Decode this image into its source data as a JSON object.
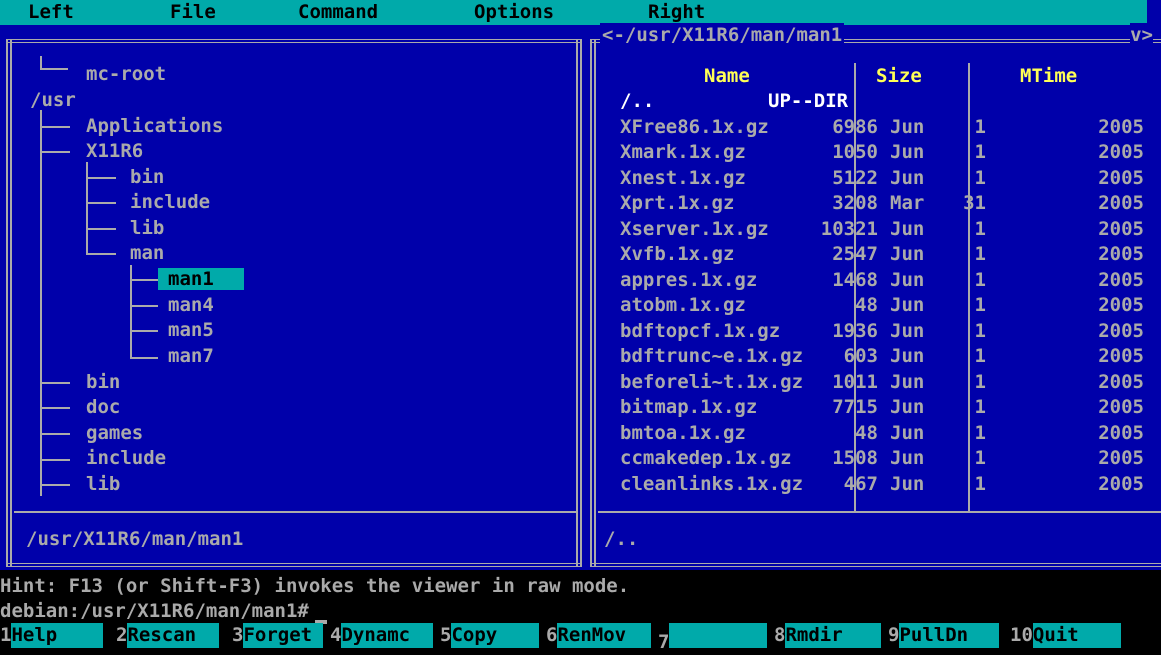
{
  "menu": {
    "items": [
      "Left",
      "File",
      "Command",
      "Options",
      "Right"
    ]
  },
  "left_panel": {
    "tree": [
      {
        "label": "mc-root"
      },
      {
        "label": "/usr"
      },
      {
        "label": "Applications"
      },
      {
        "label": "X11R6"
      },
      {
        "label": "bin"
      },
      {
        "label": "include"
      },
      {
        "label": "lib"
      },
      {
        "label": "man"
      },
      {
        "label": "man1"
      },
      {
        "label": "man4"
      },
      {
        "label": "man5"
      },
      {
        "label": "man7"
      },
      {
        "label": "bin"
      },
      {
        "label": "doc"
      },
      {
        "label": "games"
      },
      {
        "label": "include"
      },
      {
        "label": "lib"
      }
    ],
    "selected_label": "man1",
    "status_path": "/usr/X11R6/man/man1"
  },
  "right_panel": {
    "title": "<-/usr/X11R6/man/man1",
    "corner": "v>",
    "columns": {
      "name": "Name",
      "size": "Size",
      "mtime": "MTime"
    },
    "rows": [
      {
        "name": "/..",
        "size": "UP--DIR",
        "month": "",
        "day": "",
        "year": ""
      },
      {
        "name": "XFree86.1x.gz",
        "size": "6986",
        "month": "Jun",
        "day": "1",
        "year": "2005"
      },
      {
        "name": "Xmark.1x.gz",
        "size": "1050",
        "month": "Jun",
        "day": "1",
        "year": "2005"
      },
      {
        "name": "Xnest.1x.gz",
        "size": "5122",
        "month": "Jun",
        "day": "1",
        "year": "2005"
      },
      {
        "name": "Xprt.1x.gz",
        "size": "3208",
        "month": "Mar",
        "day": "31",
        "year": "2005"
      },
      {
        "name": "Xserver.1x.gz",
        "size": "10321",
        "month": "Jun",
        "day": "1",
        "year": "2005"
      },
      {
        "name": "Xvfb.1x.gz",
        "size": "2547",
        "month": "Jun",
        "day": "1",
        "year": "2005"
      },
      {
        "name": "appres.1x.gz",
        "size": "1468",
        "month": "Jun",
        "day": "1",
        "year": "2005"
      },
      {
        "name": "atobm.1x.gz",
        "size": "48",
        "month": "Jun",
        "day": "1",
        "year": "2005"
      },
      {
        "name": "bdftopcf.1x.gz",
        "size": "1936",
        "month": "Jun",
        "day": "1",
        "year": "2005"
      },
      {
        "name": "bdftrunc~e.1x.gz",
        "size": "603",
        "month": "Jun",
        "day": "1",
        "year": "2005"
      },
      {
        "name": "beforeli~t.1x.gz",
        "size": "1011",
        "month": "Jun",
        "day": "1",
        "year": "2005"
      },
      {
        "name": "bitmap.1x.gz",
        "size": "7715",
        "month": "Jun",
        "day": "1",
        "year": "2005"
      },
      {
        "name": "bmtoa.1x.gz",
        "size": "48",
        "month": "Jun",
        "day": "1",
        "year": "2005"
      },
      {
        "name": "ccmakedep.1x.gz",
        "size": "1508",
        "month": "Jun",
        "day": "1",
        "year": "2005"
      },
      {
        "name": "cleanlinks.1x.gz",
        "size": "467",
        "month": "Jun",
        "day": "1",
        "year": "2005"
      }
    ],
    "status_path": "/.."
  },
  "hint": "Hint: F13 (or Shift-F3) invokes the viewer in raw mode.",
  "prompt": "debian:/usr/X11R6/man/man1#",
  "fkeys": [
    {
      "num": "1",
      "label": "Help"
    },
    {
      "num": "2",
      "label": "Rescan"
    },
    {
      "num": "3",
      "label": "Forget"
    },
    {
      "num": "4",
      "label": "Dynamc"
    },
    {
      "num": "5",
      "label": "Copy"
    },
    {
      "num": "6",
      "label": "RenMov"
    },
    {
      "num": "7",
      "label": ""
    },
    {
      "num": "8",
      "label": "Rmdir"
    },
    {
      "num": "9",
      "label": "PullDn"
    },
    {
      "num": "10",
      "label": "Quit"
    }
  ],
  "colors": {
    "panel_bg": "#0000aa",
    "accent": "#00aaaa",
    "header_text": "#ffff55",
    "text": "#aaaaaa"
  }
}
